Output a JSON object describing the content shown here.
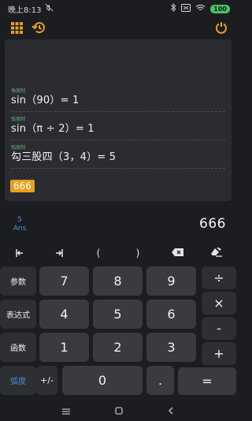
{
  "status": {
    "time": "晚上8:13",
    "battery": "100"
  },
  "toolbar": {
    "grid_icon": "grid-icon",
    "history_icon": "history-icon",
    "power_icon": "power-icon"
  },
  "history": [
    {
      "mode": "角度制",
      "expr": "sin（90）= 1"
    },
    {
      "mode": "弧度制",
      "expr": "sin（π ÷ 2）= 1"
    },
    {
      "mode": "弧度制",
      "expr": "勾三股四（3，4）= 5"
    }
  ],
  "current_input": "666",
  "ans": {
    "count": "5",
    "label": "Ans"
  },
  "result": "666",
  "controls": {
    "left": "←|",
    "right": "|→",
    "open_paren": "(",
    "close_paren": ")",
    "backspace_icon": "backspace-icon",
    "clear_icon": "eraser-icon"
  },
  "keys": {
    "params": "参数",
    "expression": "表达式",
    "functions": "函数",
    "radian": "弧度",
    "k7": "7",
    "k8": "8",
    "k9": "9",
    "k4": "4",
    "k5": "5",
    "k6": "6",
    "k1": "1",
    "k2": "2",
    "k3": "3",
    "negate": "+/-",
    "k0": "0",
    "dot": ".",
    "divide": "÷",
    "multiply": "×",
    "minus": "-",
    "plus": "+",
    "equals": "="
  },
  "colors": {
    "accent": "#4a8fe0",
    "highlight": "#e8a11c",
    "mode_label": "#5fb070",
    "battery": "#48c464"
  }
}
